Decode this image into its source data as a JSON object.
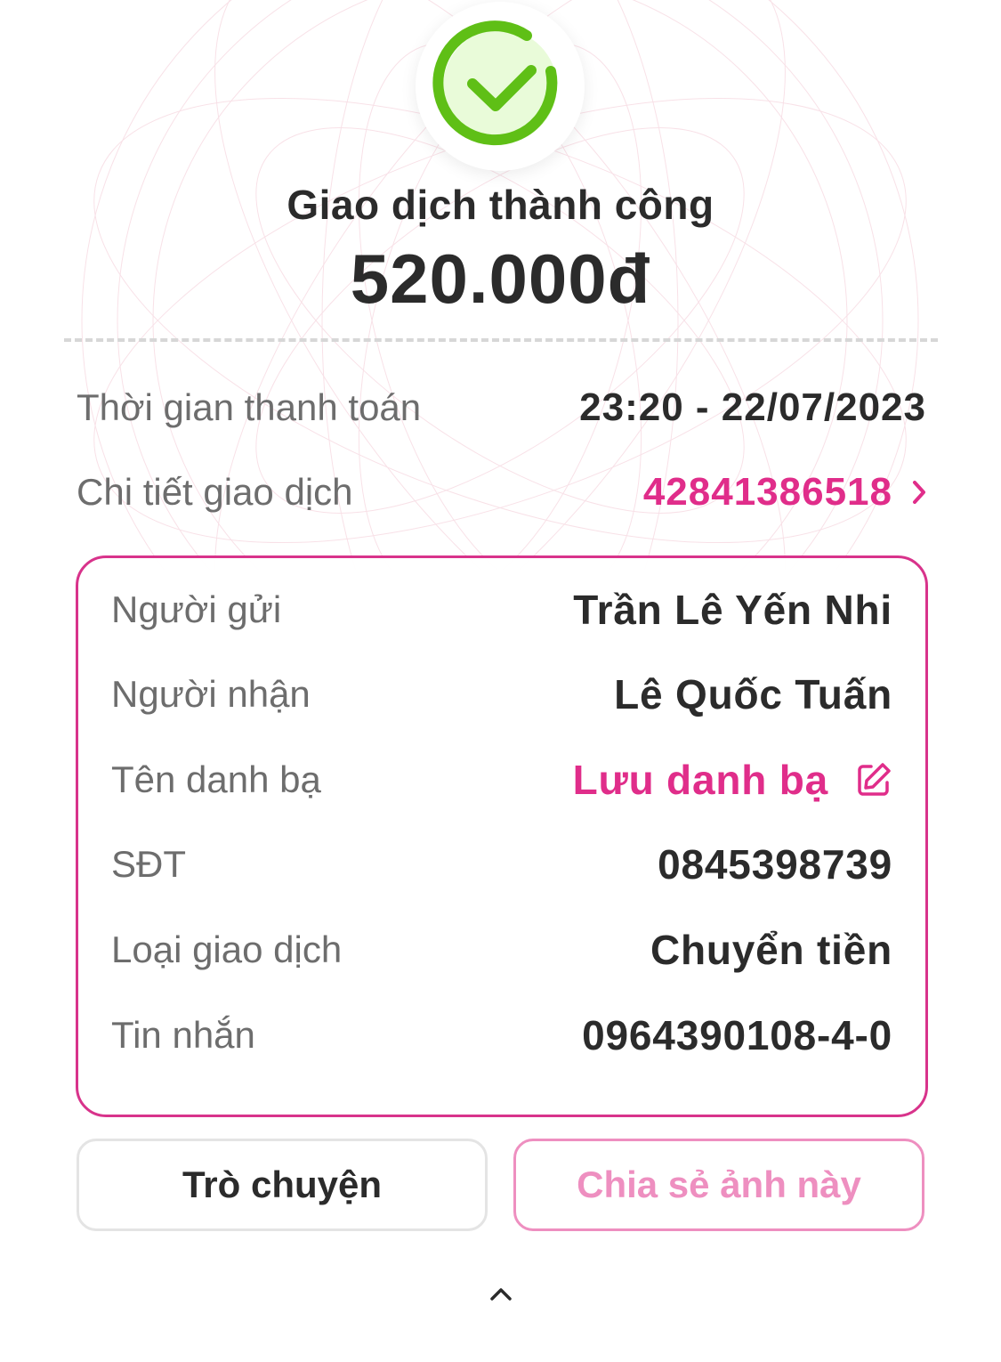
{
  "status": {
    "title": "Giao dịch thành công",
    "amount": "520.000đ",
    "icon": "check-circle-icon",
    "icon_color": "#5fbf16"
  },
  "summary": {
    "time_label": "Thời gian thanh toán",
    "time_value": "23:20 - 22/07/2023",
    "detail_label": "Chi tiết giao dịch",
    "detail_value": "42841386518"
  },
  "card": {
    "sender_label": "Người gửi",
    "sender_value": "Trần Lê Yến Nhi",
    "receiver_label": "Người nhận",
    "receiver_value": "Lê Quốc Tuấn",
    "contact_label": "Tên danh bạ",
    "contact_value": "Lưu danh bạ",
    "phone_label": "SĐT",
    "phone_value": "0845398739",
    "type_label": "Loại giao dịch",
    "type_value": "Chuyển tiền",
    "message_label": "Tin nhắn",
    "message_value": "0964390108-4-0"
  },
  "buttons": {
    "chat": "Trò chuyện",
    "share": "Chia sẻ ảnh này"
  },
  "colors": {
    "accent": "#e02d8a",
    "border": "#d8338b",
    "share_light": "#ee8fc0",
    "text": "#2b2b2b",
    "muted": "#6d6d6d"
  }
}
